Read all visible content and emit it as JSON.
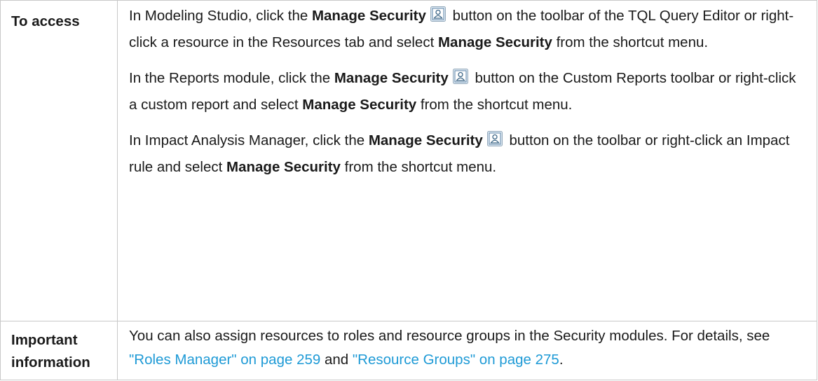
{
  "rows": [
    {
      "label": "To access",
      "paragraphs": [
        {
          "t1": "In Modeling Studio, click the ",
          "b1": "Manage Security",
          "t2": " button on the toolbar of the TQL Query Editor or right-click a resource in the Resources tab and select ",
          "b2": "Manage Security",
          "t3": " from the shortcut menu."
        },
        {
          "t1": "In the Reports module, click the ",
          "b1": "Manage Security",
          "t2": " button on the Custom Reports toolbar or right-click a custom report and select ",
          "b2": "Manage Security",
          "t3": " from the shortcut menu."
        },
        {
          "t1": "In Impact Analysis Manager, click the ",
          "b1": "Manage Security",
          "t2": " button on the toolbar or right-click an Impact rule and select ",
          "b2": "Manage Security",
          "t3": " from the shortcut menu."
        }
      ]
    },
    {
      "label": "Important information",
      "text1": "You can also assign resources to roles and resource groups in the Security modules. For details, see ",
      "link1": "\"Roles Manager\" on page 259",
      "text2": " and ",
      "link2": "\"Resource Groups\" on page 275",
      "text3": "."
    }
  ],
  "icon": "manage-security-icon",
  "colors": {
    "link": "#1e9ad6",
    "border": "#c8c8c8",
    "text": "#1a1a1a"
  }
}
